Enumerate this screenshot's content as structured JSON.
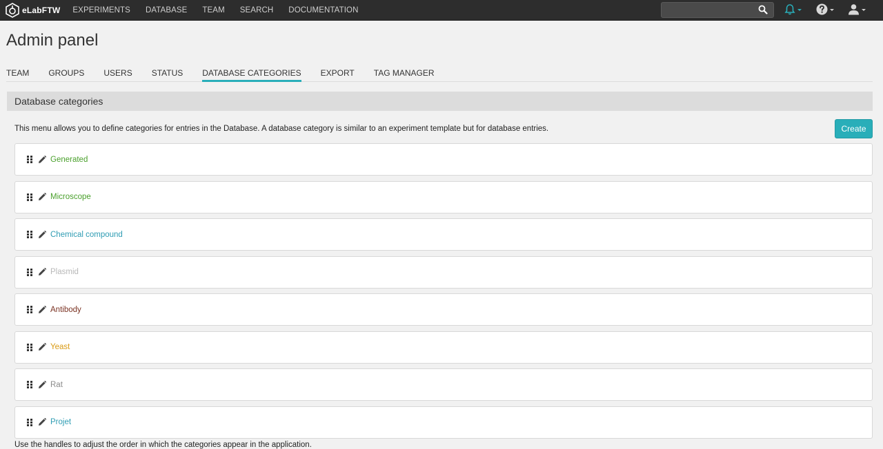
{
  "brand": {
    "name": "eLabFTW"
  },
  "nav": {
    "links": [
      "EXPERIMENTS",
      "DATABASE",
      "TEAM",
      "SEARCH",
      "DOCUMENTATION"
    ],
    "search": {
      "value": "",
      "placeholder": ""
    }
  },
  "page": {
    "title": "Admin panel"
  },
  "tabs": [
    {
      "label": "TEAM",
      "active": false
    },
    {
      "label": "GROUPS",
      "active": false
    },
    {
      "label": "USERS",
      "active": false
    },
    {
      "label": "STATUS",
      "active": false
    },
    {
      "label": "DATABASE CATEGORIES",
      "active": true
    },
    {
      "label": "EXPORT",
      "active": false
    },
    {
      "label": "TAG MANAGER",
      "active": false
    }
  ],
  "section": {
    "title": "Database categories",
    "description": "This menu allows you to define categories for entries in the Database. A database category is similar to an experiment template but for database entries.",
    "create_label": "Create",
    "footer_note": "Use the handles to adjust the order in which the categories appear in the application."
  },
  "categories": [
    {
      "name": "Generated",
      "color": "#4aa02c"
    },
    {
      "name": "Microscope",
      "color": "#4aa02c"
    },
    {
      "name": "Chemical compound",
      "color": "#2e9cb3"
    },
    {
      "name": "Plasmid",
      "color": "#b8b8b8"
    },
    {
      "name": "Antibody",
      "color": "#7a3222"
    },
    {
      "name": "Yeast",
      "color": "#d99a14"
    },
    {
      "name": "Rat",
      "color": "#8a8a8a"
    },
    {
      "name": "Projet",
      "color": "#2e9cb3"
    }
  ],
  "colors": {
    "accent": "#29aeb9",
    "navbar": "#2d2d2d"
  }
}
